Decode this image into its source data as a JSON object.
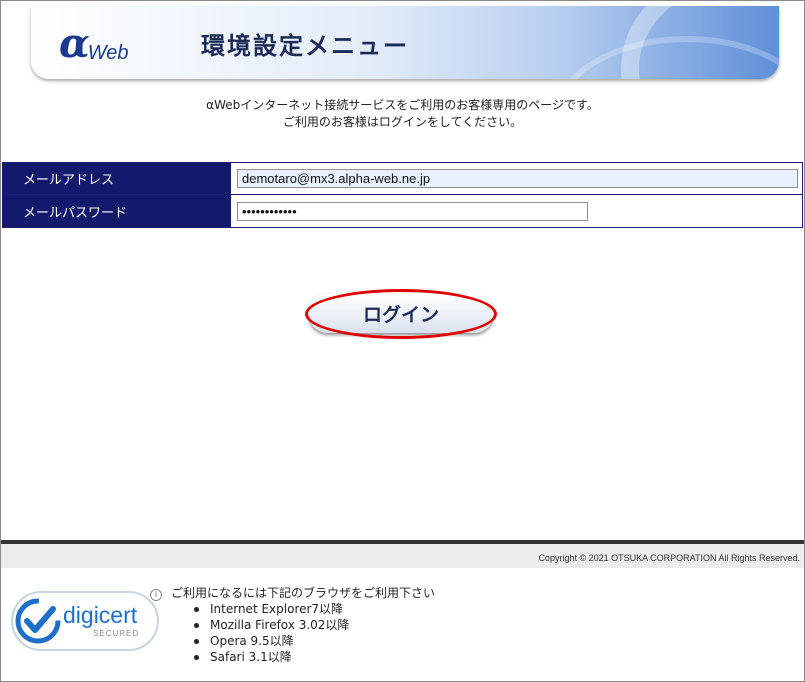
{
  "header": {
    "logo_alpha": "α",
    "logo_web": "Web",
    "title": "環境設定メニュー"
  },
  "intro": {
    "line1": "αWebインターネット接続サービスをご利用のお客様専用のページです。",
    "line2": "ご利用のお客様はログインをしてください。"
  },
  "form": {
    "email_label": "メールアドレス",
    "email_value": "demotaro@mx3.alpha-web.ne.jp",
    "password_label": "メールパスワード",
    "password_value": "••••••••••••",
    "login_label": "ログイン"
  },
  "footer": {
    "copyright": "Copyright © 2021 OTSUKA CORPORATION All Rights Reserved.",
    "seal_brand": "digicert",
    "seal_secured": "SECURED",
    "seal_info": "i",
    "browser_note": "ご利用になるには下記のブラウザをご利用下さい",
    "browsers": [
      "Internet Explorer7以降",
      "Mozilla Firefox 3.02以降",
      "Opera 9.5以降",
      "Safari 3.1以降"
    ]
  },
  "colors": {
    "label_bg": "#141a6b",
    "highlight": "#e00000",
    "seal_blue": "#1e6fc8"
  }
}
